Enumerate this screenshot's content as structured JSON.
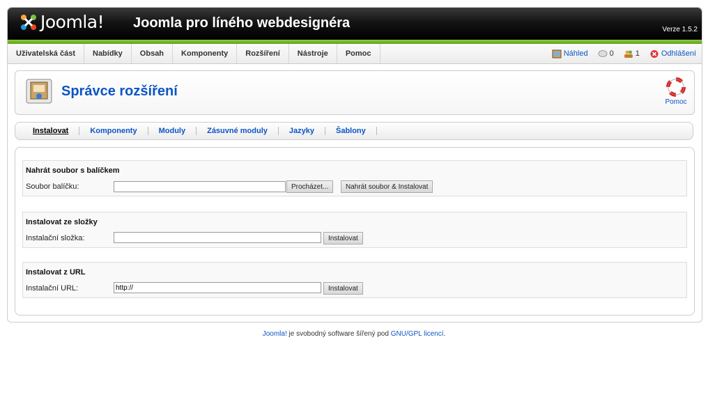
{
  "header": {
    "logo_text": "Joomla!",
    "site_title": "Joomla pro líného webdesignéra",
    "version": "Verze 1.5.2"
  },
  "menu": {
    "items": [
      {
        "label": "Uživatelská část"
      },
      {
        "label": "Nabídky"
      },
      {
        "label": "Obsah"
      },
      {
        "label": "Komponenty"
      },
      {
        "label": "Rozšíření"
      },
      {
        "label": "Nástroje"
      },
      {
        "label": "Pomoc"
      }
    ]
  },
  "status": {
    "preview_label": "Náhled",
    "messages_count": "0",
    "users_count": "1",
    "logout_label": "Odhlášení"
  },
  "toolbar": {
    "title": "Správce rozšíření",
    "help_label": "Pomoc"
  },
  "submenu": {
    "items": [
      {
        "label": "Instalovat",
        "active": true
      },
      {
        "label": "Komponenty"
      },
      {
        "label": "Moduly"
      },
      {
        "label": "Zásuvné moduly"
      },
      {
        "label": "Jazyky"
      },
      {
        "label": "Šablony"
      }
    ]
  },
  "upload": {
    "title": "Nahrát soubor s balíčkem",
    "label": "Soubor balíčku:",
    "value": "",
    "browse_label": "Procházet...",
    "submit_label": "Nahrát soubor & Instalovat"
  },
  "folder": {
    "title": "Instalovat ze složky",
    "label": "Instalační složka:",
    "value": "",
    "submit_label": "Instalovat"
  },
  "url": {
    "title": "Instalovat z URL",
    "label": "Instalační URL:",
    "value": "http://",
    "submit_label": "Instalovat"
  },
  "footer": {
    "brand": "Joomla!",
    "text_middle": " je svobodný software šířený pod ",
    "license": "GNU/GPL licencí",
    "text_end": "."
  },
  "colors": {
    "accent": "#0b55c4",
    "header_bg": "#000000",
    "green_bar": "#6fb82a"
  }
}
